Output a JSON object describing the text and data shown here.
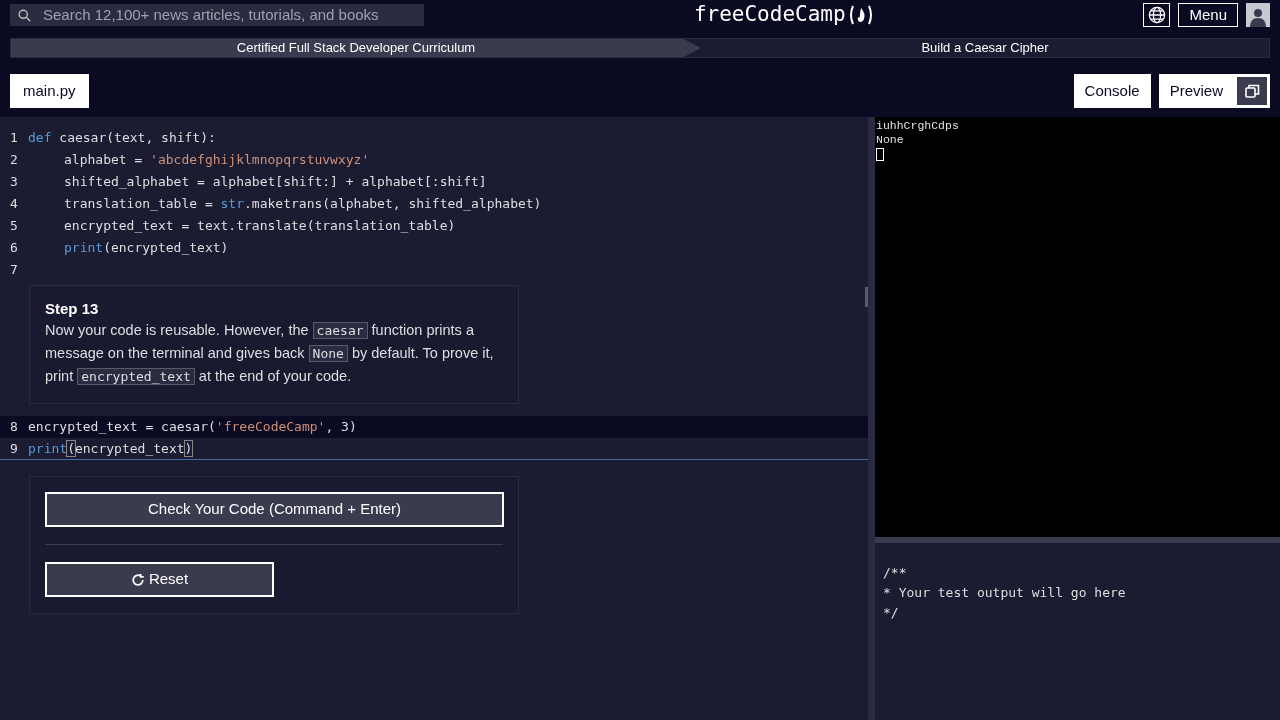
{
  "header": {
    "search": {
      "placeholder": "Search 12,100+ news articles, tutorials, and books"
    },
    "logo": "freeCodeCamp",
    "menu_button": "Menu"
  },
  "breadcrumb": [
    {
      "label": "Certified Full Stack Developer Curriculum",
      "kind": "parent"
    },
    {
      "label": "Build a Caesar Cipher",
      "kind": "current"
    }
  ],
  "file_tabs": [
    {
      "label": "main.py",
      "selected": true
    }
  ],
  "panel_buttons": [
    "Console",
    "Preview"
  ],
  "code_top": [
    {
      "number": "1",
      "tokens": [
        {
          "text": "def",
          "kind": "kw"
        },
        {
          "text": " caesar(text, shift):",
          "kind": "plain"
        }
      ],
      "children": [
        {
          "number": "2",
          "tokens": [
            {
              "text": "alphabet = ",
              "kind": "plain"
            },
            {
              "text": "'abcdefghijklmnopqrstuvwxyz'",
              "kind": "str"
            }
          ]
        },
        {
          "number": "3",
          "tokens": [
            {
              "text": "shifted_alphabet = alphabet[shift:] + alphabet[:shift]",
              "kind": "plain"
            }
          ]
        },
        {
          "number": "4",
          "tokens": [
            {
              "text": "translation_table = ",
              "kind": "plain"
            },
            {
              "text": "str",
              "kind": "fn"
            },
            {
              "text": ".maketrans(alphabet, shifted_alphabet)",
              "kind": "plain"
            }
          ]
        },
        {
          "number": "5",
          "tokens": [
            {
              "text": "encrypted_text = text.translate(translation_table)",
              "kind": "plain"
            }
          ]
        },
        {
          "number": "6",
          "tokens": [
            {
              "text": "print",
              "kind": "fn"
            },
            {
              "text": "(encrypted_text)",
              "kind": "plain"
            }
          ]
        }
      ]
    },
    {
      "number": "7"
    }
  ],
  "step": {
    "title": "Step 13",
    "description": [
      {
        "text": "Now your code is reusable. However, the ",
        "kind": "text"
      },
      {
        "text": "caesar",
        "kind": "code"
      },
      {
        "text": " function prints a message on the terminal and gives back ",
        "kind": "text"
      },
      {
        "text": "None",
        "kind": "code"
      },
      {
        "text": " by default. To prove it, print ",
        "kind": "text"
      },
      {
        "text": "encrypted_text",
        "kind": "code"
      },
      {
        "text": " at the end of your code.",
        "kind": "text"
      }
    ]
  },
  "code_bottom": [
    {
      "number": "8",
      "tokens": [
        {
          "text": "encrypted_text = caesar(",
          "kind": "plain"
        },
        {
          "text": "'freeCodeCamp'",
          "kind": "str"
        },
        {
          "text": ", 3)",
          "kind": "plain"
        }
      ]
    },
    {
      "number": "9",
      "tokens": [
        {
          "text": "print",
          "kind": "fn"
        },
        {
          "text": "(",
          "kind": "bracket"
        },
        {
          "text": "encrypted_text",
          "kind": "plain"
        },
        {
          "text": ")",
          "kind": "bracket"
        }
      ]
    }
  ],
  "check_button": "Check Your Code (Command + Enter)",
  "reset_button": "Reset",
  "console_output": [
    "iuhhCrghCdps",
    "None"
  ],
  "test_output": [
    "/**",
    "* Your test output will go here",
    "*/"
  ]
}
